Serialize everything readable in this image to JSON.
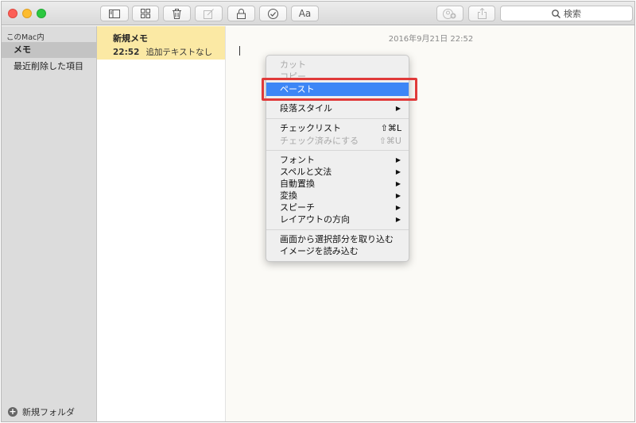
{
  "toolbar": {
    "buttons": [
      {
        "name": "sidebar-toggle",
        "icon": "sidebar-icon"
      },
      {
        "name": "gallery-view",
        "icon": "grid-icon"
      },
      {
        "name": "delete",
        "icon": "trash-icon"
      },
      {
        "name": "new-note",
        "icon": "compose-icon"
      },
      {
        "name": "lock",
        "icon": "lock-icon"
      },
      {
        "name": "checklist",
        "icon": "check-circle-icon"
      },
      {
        "name": "format",
        "label": "Aa"
      },
      {
        "name": "share-add-people",
        "icon": "add-people-icon"
      },
      {
        "name": "share",
        "icon": "share-icon"
      }
    ],
    "format_label": "Aa",
    "search_placeholder": "検索"
  },
  "sidebar": {
    "section": "このMac内",
    "items": [
      {
        "label": "メモ",
        "selected": true
      },
      {
        "label": "最近削除した項目",
        "selected": false
      }
    ],
    "new_folder": "新規フォルダ"
  },
  "notes": [
    {
      "title": "新規メモ",
      "time": "22:52",
      "preview": "追加テキストなし",
      "selected": true
    }
  ],
  "editor": {
    "date": "2016年9月21日 22:52"
  },
  "context_menu": {
    "items": {
      "cut": "カット",
      "copy": "コピー",
      "paste": "ペースト",
      "paragraph_style": "段落スタイル",
      "checklist": "チェックリスト",
      "checklist_shortcut": "⇧⌘L",
      "mark_checked": "チェック済みにする",
      "mark_checked_shortcut": "⇧⌘U",
      "font": "フォント",
      "spelling": "スペルと文法",
      "substitutions": "自動置換",
      "transformations": "変換",
      "speech": "スピーチ",
      "layout_direction": "レイアウトの方向",
      "capture_selection": "画面から選択部分を取り込む",
      "import_image": "イメージを読み込む"
    }
  },
  "colors": {
    "highlight": "#3d86f6",
    "annotation_box": "#e03a3a",
    "note_selected": "#fbe9a4"
  }
}
